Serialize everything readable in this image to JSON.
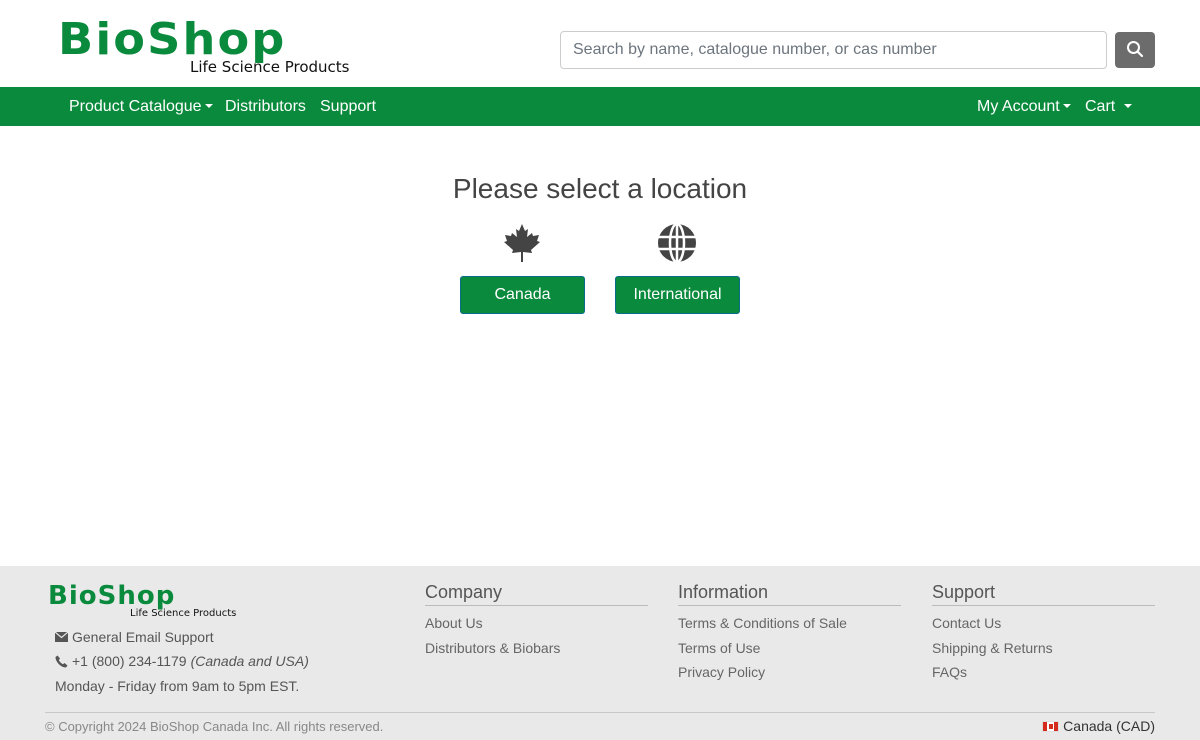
{
  "header": {
    "logo_text": "BioShop",
    "logo_tagline": "Life Science Products",
    "search_placeholder": "Search by name, catalogue number, or cas number",
    "search_icon": "search-icon"
  },
  "nav": {
    "left": [
      {
        "label": "Product Catalogue",
        "dropdown": true
      },
      {
        "label": "Distributors",
        "dropdown": false
      },
      {
        "label": "Support",
        "dropdown": false
      }
    ],
    "right": [
      {
        "label": "My Account",
        "dropdown": true
      },
      {
        "label": "Cart",
        "dropdown": true
      }
    ],
    "bg_color": "#0a8a3c"
  },
  "main": {
    "title": "Please select a location",
    "locations": [
      {
        "label": "Canada",
        "icon": "maple-leaf-icon"
      },
      {
        "label": "International",
        "icon": "globe-icon"
      }
    ]
  },
  "footer": {
    "logo_text": "BioShop",
    "logo_tagline": "Life Science Products",
    "email_label": "General Email Support",
    "phone": "+1 (800) 234-1179",
    "phone_note": "(Canada and USA)",
    "hours": "Monday - Friday from 9am to 5pm EST.",
    "columns": [
      {
        "title": "Company",
        "links": [
          "About Us",
          "Distributors & Biobars"
        ]
      },
      {
        "title": "Information",
        "links": [
          "Terms & Conditions of Sale",
          "Terms of Use",
          "Privacy Policy"
        ]
      },
      {
        "title": "Support",
        "links": [
          "Contact Us",
          "Shipping & Returns",
          "FAQs"
        ]
      }
    ],
    "copyright": "© Copyright 2024 BioShop Canada Inc. All rights reserved.",
    "region": "Canada (CAD)"
  },
  "colors": {
    "brand_green": "#0a8a3c",
    "footer_bg": "#e9e9e9"
  }
}
